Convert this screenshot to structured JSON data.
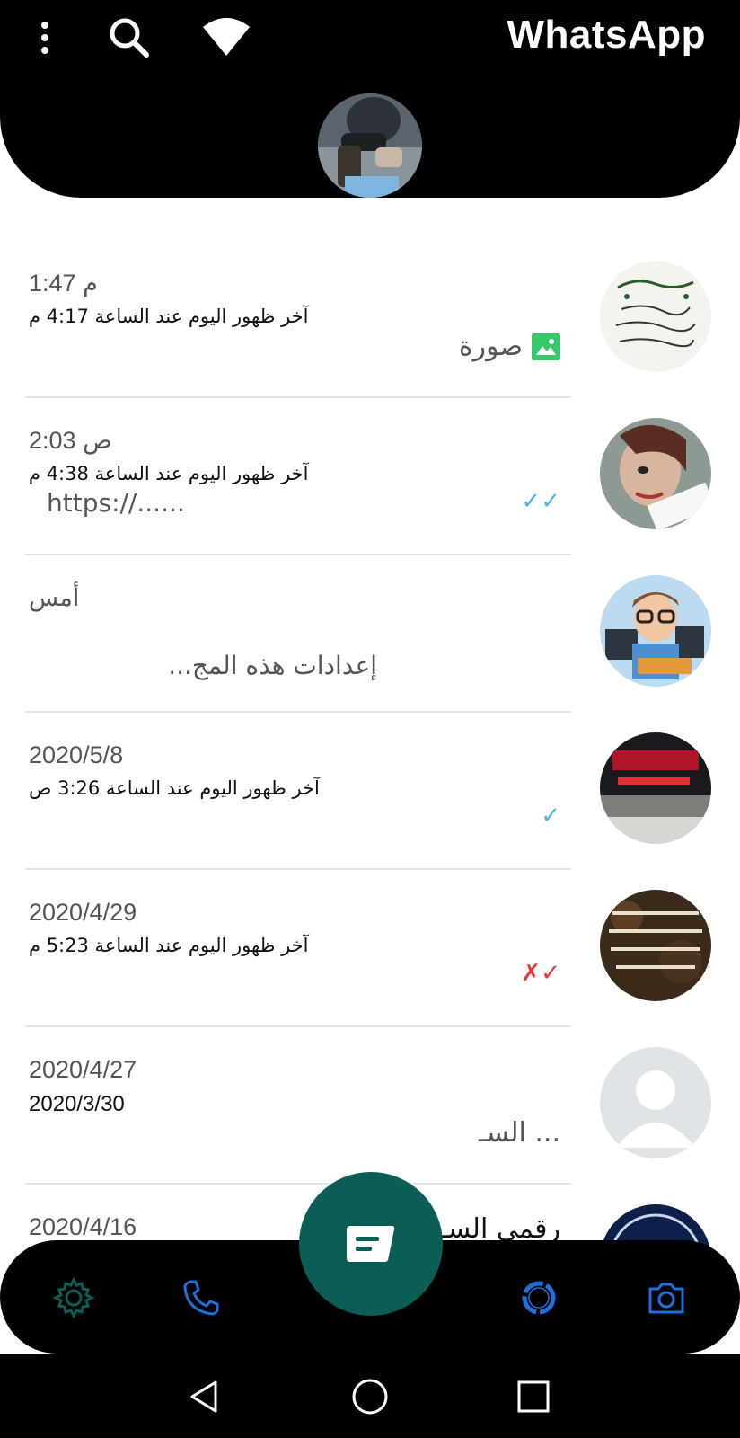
{
  "header": {
    "app_title": "WhatsApp",
    "icons": [
      "more-vert-icon",
      "search-icon",
      "wifi-icon"
    ],
    "background": "#000000"
  },
  "chats": [
    {
      "time": "1:47 م",
      "last_seen": "آخر ظهور اليوم عند الساعة 4:17 م",
      "preview": "صورة",
      "preview_icon": "photo-icon"
    },
    {
      "time": "2:03 ص",
      "last_seen": "آخر ظهور اليوم عند الساعة 4:38 م",
      "preview": "https://......",
      "status": "read-ticks"
    },
    {
      "time": "أمس",
      "last_seen": "",
      "preview": "إعدادات هذه المج..."
    },
    {
      "time": "2020/5/8",
      "last_seen": "آخر ظهور اليوم عند الساعة 3:26 ص",
      "preview": "",
      "status": "read-ticks"
    },
    {
      "time": "2020/4/29",
      "last_seen": "آخر ظهور اليوم عند الساعة 5:23 م",
      "preview": "",
      "status": "red-ticks"
    },
    {
      "time": "2020/4/27",
      "last_seen": "2020/3/30",
      "preview": "... السـ"
    },
    {
      "time": "2020/4/16",
      "last_seen": "",
      "preview": "رقمي السـ"
    }
  ],
  "colors": {
    "fab": "#0b5e55",
    "settings_icon": "#0b5e55",
    "accent_blue": "#1e6fd9",
    "read_ticks": "#4fb3e8"
  },
  "bottom_nav": [
    "settings-icon",
    "phone-icon",
    "status-icon",
    "camera-icon"
  ],
  "system_nav": [
    "back-icon",
    "home-icon",
    "recents-icon"
  ]
}
